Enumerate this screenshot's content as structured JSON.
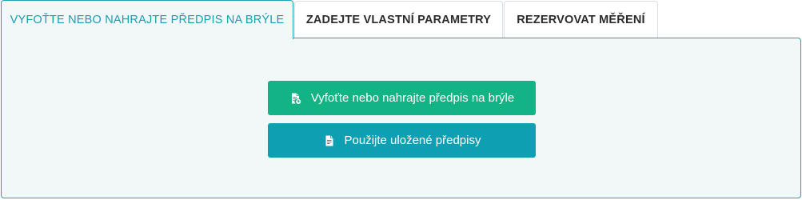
{
  "tabs": [
    {
      "label": "VYFOŤTE NEBO NAHRAJTE PŘEDPIS NA BRÝLE",
      "active": true
    },
    {
      "label": "ZADEJTE VLASTNÍ PARAMETRY",
      "active": false
    },
    {
      "label": "REZERVOVAT MĚŘENÍ",
      "active": false
    }
  ],
  "panel": {
    "upload_button": {
      "label": "Vyfoťte nebo nahrajte předpis na brýle",
      "icon": "document-upload-icon",
      "color": "#12b384"
    },
    "saved_button": {
      "label": "Použijte uložené předpisy",
      "icon": "document-icon",
      "color": "#0f9fb2"
    }
  },
  "colors": {
    "accent": "#1aa4b4",
    "panel_background": "#f2f7f7"
  }
}
